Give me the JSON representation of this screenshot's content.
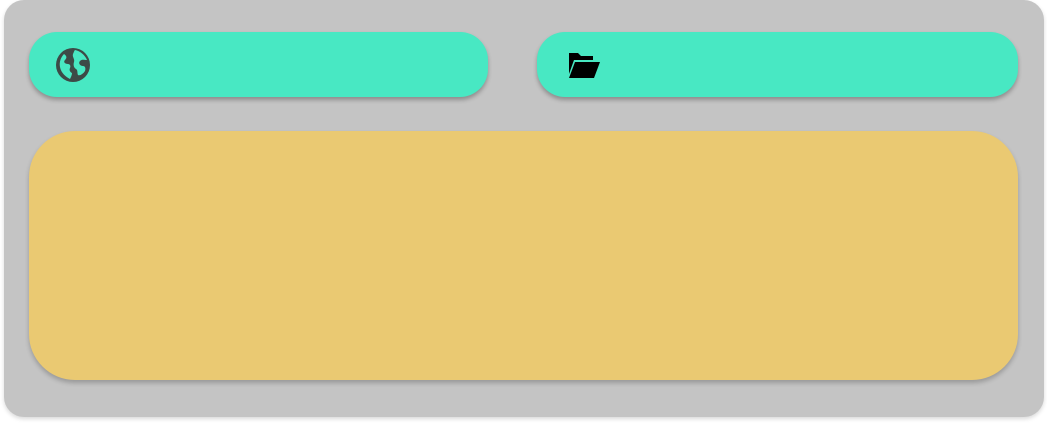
{
  "colors": {
    "panel_background": "#c4c4c4",
    "pill_background": "#48e8c3",
    "content_background": "#eac972",
    "globe_icon": "#3d4a47",
    "folder_icon": "#000000"
  },
  "url_bar": {
    "icon": "globe-icon",
    "text": ""
  },
  "folder_bar": {
    "icon": "open-folder-icon",
    "text": ""
  },
  "content_panel": {
    "text": ""
  }
}
